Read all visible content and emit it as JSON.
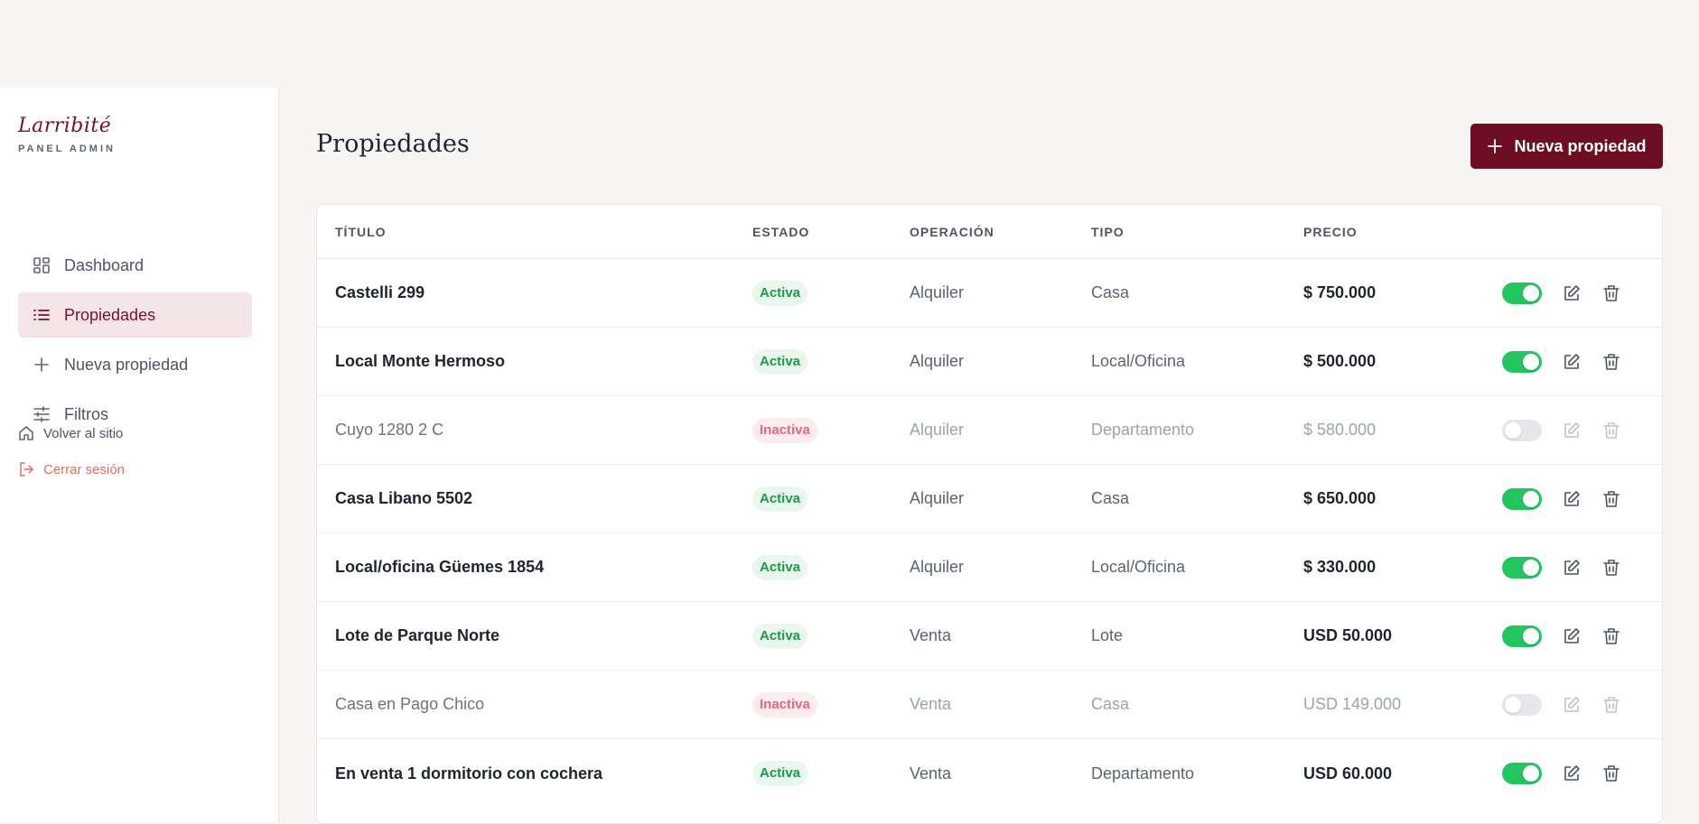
{
  "brand": {
    "logo": "Larribité",
    "subtitle": "PANEL ADMIN"
  },
  "sidebar": {
    "items": [
      {
        "label": "Dashboard",
        "icon": "dashboard-grid-icon",
        "active": false
      },
      {
        "label": "Propiedades",
        "icon": "list-icon",
        "active": true
      },
      {
        "label": "Nueva propiedad",
        "icon": "plus-icon",
        "active": false
      },
      {
        "label": "Filtros",
        "icon": "sliders-icon",
        "active": false
      }
    ],
    "links": [
      {
        "label": "Volver al sitio",
        "icon": "home-icon"
      },
      {
        "label": "Cerrar sesión",
        "icon": "logout-icon"
      }
    ]
  },
  "header": {
    "title": "Propiedades",
    "new_button": "Nueva propiedad"
  },
  "table": {
    "headers": {
      "titulo": "TÍTULO",
      "estado": "ESTADO",
      "operacion": "OPERACIÓN",
      "tipo": "TIPO",
      "precio": "PRECIO"
    },
    "rows": [
      {
        "titulo": "Castelli 299",
        "estado": "Activa",
        "operacion": "Alquiler",
        "tipo": "Casa",
        "precio": "$ 750.000",
        "active": true
      },
      {
        "titulo": "Local Monte Hermoso",
        "estado": "Activa",
        "operacion": "Alquiler",
        "tipo": "Local/Oficina",
        "precio": "$ 500.000",
        "active": true
      },
      {
        "titulo": "Cuyo 1280 2 C",
        "estado": "Inactiva",
        "operacion": "Alquiler",
        "tipo": "Departamento",
        "precio": "$ 580.000",
        "active": false
      },
      {
        "titulo": "Casa Libano 5502",
        "estado": "Activa",
        "operacion": "Alquiler",
        "tipo": "Casa",
        "precio": "$ 650.000",
        "active": true
      },
      {
        "titulo": "Local/oficina Güemes 1854",
        "estado": "Activa",
        "operacion": "Alquiler",
        "tipo": "Local/Oficina",
        "precio": "$ 330.000",
        "active": true
      },
      {
        "titulo": "Lote de Parque Norte",
        "estado": "Activa",
        "operacion": "Venta",
        "tipo": "Lote",
        "precio": "USD 50.000",
        "active": true
      },
      {
        "titulo": "Casa en Pago Chico",
        "estado": "Inactiva",
        "operacion": "Venta",
        "tipo": "Casa",
        "precio": "USD 149.000",
        "active": false
      },
      {
        "titulo": "En venta 1 dormitorio con cochera",
        "estado": "Activa",
        "operacion": "Venta",
        "tipo": "Departamento",
        "precio": "USD 60.000",
        "active": true
      }
    ]
  },
  "colors": {
    "brand": "#6e0e22",
    "active": "#22c55e",
    "badge_active": "#1d9a47",
    "badge_inactive": "#e06a7a"
  }
}
